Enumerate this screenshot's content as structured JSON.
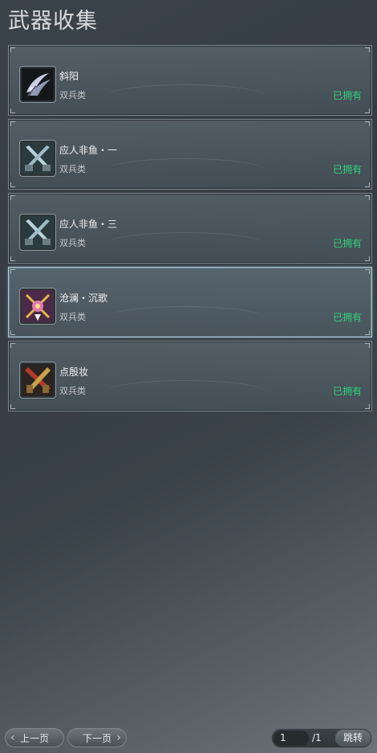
{
  "title": "武器收集",
  "items": [
    {
      "name": "斜阳",
      "type": "双兵类",
      "status": "已拥有",
      "icon": "scythe-blades-icon",
      "selected": false
    },
    {
      "name": "应人非鱼・一",
      "type": "双兵类",
      "status": "已拥有",
      "icon": "crossed-swords-icon",
      "selected": false
    },
    {
      "name": "应人非鱼・三",
      "type": "双兵类",
      "status": "已拥有",
      "icon": "crossed-swords-icon",
      "selected": false
    },
    {
      "name": "沧澜・沉歌",
      "type": "双兵类",
      "status": "已拥有",
      "icon": "ornate-crossed-blades-icon",
      "selected": true
    },
    {
      "name": "点殷妆",
      "type": "双兵类",
      "status": "已拥有",
      "icon": "red-crossed-blades-icon",
      "selected": false
    }
  ],
  "pager": {
    "prev_label": "上一页",
    "next_label": "下一页",
    "current_page": "1",
    "total_pages": "/1",
    "jump_label": "跳转"
  },
  "colors": {
    "owned": "#2fd17a",
    "selected_border": "#a9c3d0"
  }
}
